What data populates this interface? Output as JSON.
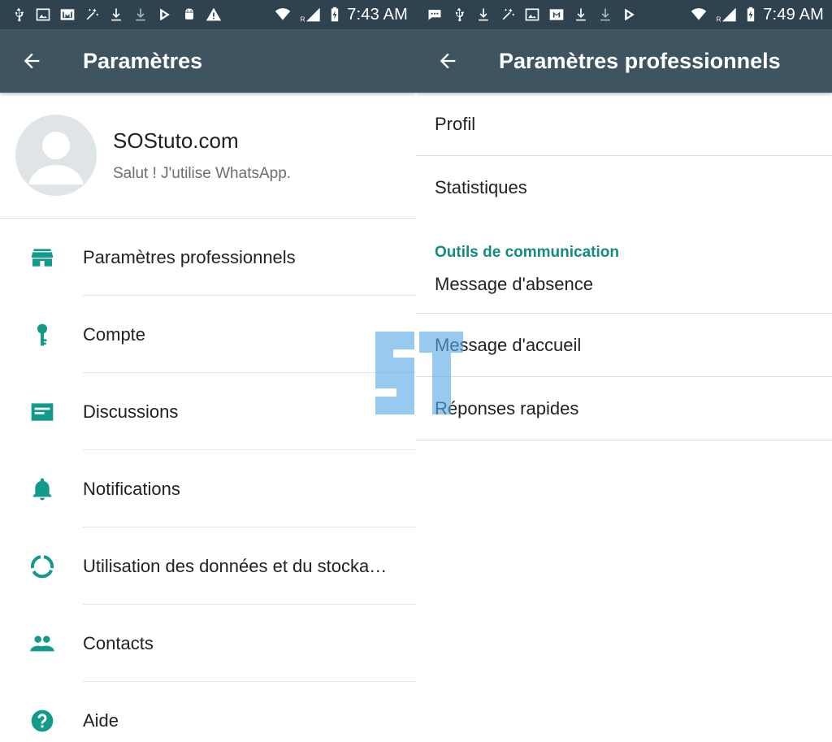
{
  "left": {
    "statusbar": {
      "time": "7:43 AM",
      "icons": [
        "usb-icon",
        "image-icon",
        "mail-icon",
        "magic-wand-icon",
        "download-icon",
        "download-icon",
        "play-store-icon",
        "android-icon",
        "warning-icon",
        "wifi-icon",
        "roaming-icon",
        "signal-icon",
        "battery-charging-icon"
      ],
      "roaming_label": "R"
    },
    "appbar": {
      "back_icon": "arrow-back-icon",
      "title": "Paramètres"
    },
    "profile": {
      "name": "SOStuto.com",
      "status": "Salut ! J'utilise WhatsApp."
    },
    "items": [
      {
        "label": "Paramètres professionnels",
        "icon": "store-icon"
      },
      {
        "label": "Compte",
        "icon": "key-icon"
      },
      {
        "label": "Discussions",
        "icon": "chat-icon"
      },
      {
        "label": "Notifications",
        "icon": "bell-icon"
      },
      {
        "label": "Utilisation des données et du stocka…",
        "icon": "data-usage-icon"
      },
      {
        "label": "Contacts",
        "icon": "people-icon"
      },
      {
        "label": "Aide",
        "icon": "help-icon"
      }
    ]
  },
  "right": {
    "statusbar": {
      "time": "7:49 AM",
      "icons": [
        "message-icon",
        "usb-icon",
        "download-icon",
        "magic-wand-icon",
        "image-icon",
        "mail-icon",
        "download-icon",
        "download-icon",
        "play-store-icon",
        "wifi-icon",
        "roaming-icon",
        "signal-icon",
        "battery-charging-icon"
      ],
      "roaming_label": "R"
    },
    "appbar": {
      "back_icon": "arrow-back-icon",
      "title": "Paramètres professionnels"
    },
    "items": [
      {
        "label": "Profil"
      },
      {
        "label": "Statistiques"
      }
    ],
    "section_header": "Outils de communication",
    "section_items": [
      {
        "label": "Message d'absence"
      },
      {
        "label": "Message d'accueil"
      },
      {
        "label": "Réponses rapides"
      }
    ]
  },
  "colors": {
    "statusbar": "#2e424f",
    "appbar": "#3e5561",
    "accent_teal": "#128c7e",
    "icon_teal": "#129a8a",
    "text_primary": "#212121",
    "text_secondary": "#6e6e6e",
    "watermark_blue": "#5aa9e6"
  },
  "watermark": {
    "text": "ST",
    "icon": "st-logo-watermark"
  }
}
